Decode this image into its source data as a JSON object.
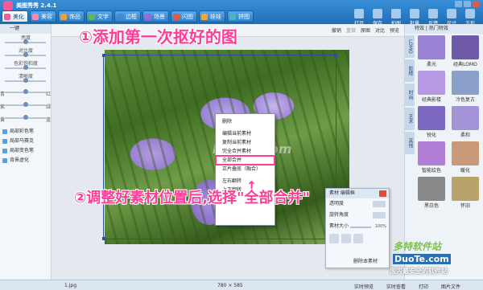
{
  "app": {
    "title": "美图秀秀 2.4.1"
  },
  "tabs": [
    {
      "label": "美化",
      "color": "#f35c9a"
    },
    {
      "label": "美容",
      "color": "#f78bb6"
    },
    {
      "label": "饰品",
      "color": "#e8a23b"
    },
    {
      "label": "文字",
      "color": "#5fb85a"
    },
    {
      "label": "边框",
      "color": "#3f8bd6"
    },
    {
      "label": "场景",
      "color": "#9b6ad3"
    },
    {
      "label": "闪图",
      "color": "#e05a4a"
    },
    {
      "label": "娃娃",
      "color": "#f2a531"
    },
    {
      "label": "拼图",
      "color": "#4bb3c8"
    }
  ],
  "top_tools": [
    "打开",
    "保存",
    "拍图",
    "批量",
    "反馈",
    "尺寸",
    "方形"
  ],
  "left_panel": {
    "header": "一键",
    "sliders": [
      {
        "label": "亮度",
        "left": "",
        "right": ""
      },
      {
        "label": "对比度",
        "left": "",
        "right": ""
      },
      {
        "label": "色彩饱和度",
        "left": "",
        "right": ""
      },
      {
        "label": "清晰度",
        "left": "",
        "right": ""
      },
      {
        "label": "",
        "left": "青",
        "right": "红"
      },
      {
        "label": "",
        "left": "紫",
        "right": "绿"
      },
      {
        "label": "",
        "left": "黄",
        "right": "蓝"
      }
    ],
    "items": [
      "局部彩色笔",
      "局部马赛克",
      "局部变色笔",
      "背景虚化"
    ]
  },
  "toolbar2": {
    "items": [
      "撤销",
      "重做",
      "原图",
      "对比",
      "预览"
    ]
  },
  "annotations": {
    "step1": "①添加第一次抠好的图",
    "step2": "②调整好素材位置后,选择\"全部合并\"",
    "watermark": "DuoTe.com"
  },
  "context_menu": {
    "items": [
      "删除",
      "编辑当前素材",
      "复制当前素材",
      "完全合并素材",
      "全部合并",
      "正片叠底（融合）",
      "左右翻转",
      "上下翻转"
    ],
    "highlighted": "全部合并"
  },
  "sucai_panel": {
    "title": "素材 编辑框",
    "rows": [
      "透明度",
      "旋转角度",
      "素材大小"
    ],
    "value": "100%",
    "delete": "删除本素材"
  },
  "right_panel": {
    "header": "特效 | 热门特效",
    "vtabs": [
      "LOMO",
      "影楼",
      "时尚",
      "艺术",
      "其他"
    ],
    "effects": [
      {
        "label": "柔光",
        "color": "#9a82d6"
      },
      {
        "label": "经典LOMO",
        "color": "#6e5aa8"
      },
      {
        "label": "经典影楼",
        "color": "#b59ae3"
      },
      {
        "label": "冷色复古",
        "color": "#8aa0c8"
      },
      {
        "label": "锐化",
        "color": "#7c68c0"
      },
      {
        "label": "柔和",
        "color": "#a493d6"
      },
      {
        "label": "智能绘色",
        "color": "#b27fd6"
      },
      {
        "label": "暖化",
        "color": "#c89a7a"
      },
      {
        "label": "黑白色",
        "color": "#888888"
      },
      {
        "label": "怀旧",
        "color": "#b8a46a"
      },
      {
        "label": "",
        "color": "#555555"
      },
      {
        "label": "",
        "color": "#777777"
      }
    ]
  },
  "status": {
    "filename": "1.jpg",
    "size": "780 × 585",
    "s1": "实时预览",
    "s2": "实时查看",
    "s3": "打印",
    "s4": "图片文件"
  },
  "brand": {
    "b1": "多特软件站",
    "b2": "DuoTe.com",
    "b3": "国内最安全的软件站"
  }
}
